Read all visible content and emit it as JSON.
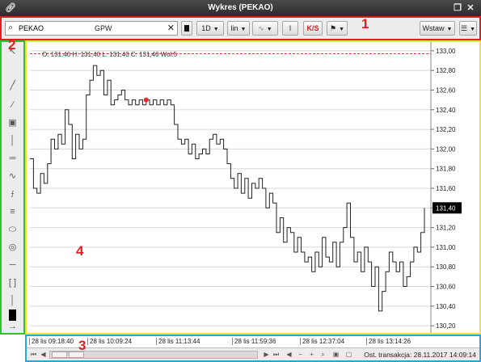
{
  "window": {
    "title": "Wykres (PEKAO)"
  },
  "toolbar": {
    "symbol": "PEKAO",
    "exchange": "GPW",
    "interval": "1D",
    "scale": "lin",
    "indicator_label": "K/S",
    "insert_label": "Wstaw"
  },
  "markers": {
    "m1": "1",
    "m2": "2",
    "m3": "3",
    "m4": "4"
  },
  "ohlc_line": "O: 131,40  H: 131,40  L: 131,40  C: 131,40  Wol:5",
  "price_tag": "131,40",
  "time_axis": {
    "labels": [
      "28 lis 09:18:40",
      "28 lis 10:09:24",
      "28 lis 11:13:44",
      "28 lis 11:59:36",
      "28 lis 12:37:04",
      "28 lis 13:14:26"
    ]
  },
  "status": {
    "last_transaction": "Ost. transakcja: 28.11.2017 14:09:14"
  },
  "colors": {
    "toolbar_border": "#e02020",
    "tools_border": "#2fc42f",
    "chart_border": "#f2e335",
    "bottom_border": "#2aa6dc"
  },
  "chart_data": {
    "type": "line",
    "y_ticks": [
      "133,00",
      "132,80",
      "132,60",
      "132,40",
      "132,20",
      "132,00",
      "131,80",
      "131,60",
      "131,40",
      "131,20",
      "131,00",
      "130,80",
      "130,60",
      "130,40",
      "130,20"
    ],
    "ylim": [
      130.16,
      133.04
    ],
    "grid": true,
    "reference_line": 132.97,
    "last_price": 131.4,
    "series": [
      {
        "values": [
          131.9,
          131.6,
          131.55,
          131.75,
          131.65,
          131.85,
          132.1,
          132.0,
          132.15,
          132.05,
          132.4,
          132.25,
          131.9,
          132.15,
          132.0,
          132.1,
          132.55,
          132.7,
          132.85,
          132.75,
          132.8,
          132.55,
          132.7,
          132.45,
          132.5,
          132.55,
          132.6,
          132.5,
          132.45,
          132.5,
          132.45,
          132.5,
          132.45,
          132.5,
          132.45,
          132.5,
          132.45,
          132.5,
          132.45,
          132.5,
          132.45,
          132.25,
          132.1,
          132.05,
          132.1,
          131.95,
          132.05,
          131.9,
          131.95,
          132.0,
          131.95,
          132.1,
          132.15,
          132.05,
          132.1,
          132.0,
          131.85,
          131.7,
          131.6,
          131.75,
          131.55,
          131.7,
          131.5,
          131.65,
          131.6,
          131.7,
          131.6,
          131.4,
          131.55,
          131.45,
          131.15,
          131.3,
          131.05,
          131.2,
          131.15,
          130.95,
          131.1,
          130.95,
          130.85,
          130.9,
          130.75,
          130.95,
          130.8,
          131.1,
          130.9,
          130.85,
          131.05,
          130.8,
          131.05,
          131.2,
          131.45,
          131.1,
          130.85,
          130.95,
          130.75,
          131.0,
          130.85,
          130.6,
          130.8,
          130.35,
          130.55,
          130.75,
          130.95,
          130.85,
          130.75,
          130.85,
          130.6,
          130.7,
          130.85,
          131.0,
          130.95,
          131.15,
          131.4
        ]
      }
    ]
  }
}
